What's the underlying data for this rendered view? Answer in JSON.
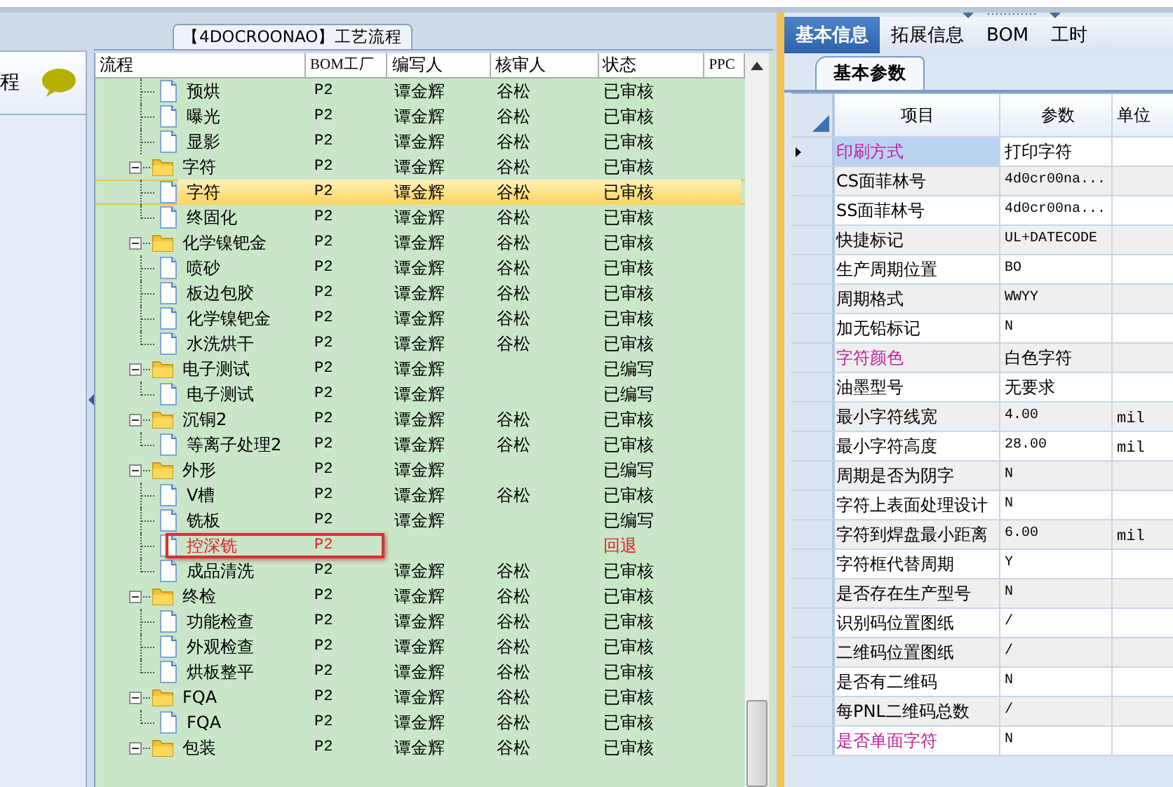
{
  "left_panel": {
    "title": "程"
  },
  "flow_panel": {
    "tab": "【4DOCROONAO】工艺流程",
    "columns": [
      "流程",
      "BOM工厂",
      "编写人",
      "核审人",
      "状态",
      "PPC"
    ],
    "tree": [
      {
        "kind": "step",
        "name": "预烘",
        "bom": "P2",
        "writer": "谭金辉",
        "reviewer": "谷松",
        "status": "已审核",
        "selected": false,
        "flagged": false
      },
      {
        "kind": "step",
        "name": "曝光",
        "bom": "P2",
        "writer": "谭金辉",
        "reviewer": "谷松",
        "status": "已审核",
        "selected": false,
        "flagged": false
      },
      {
        "kind": "step",
        "name": "显影",
        "bom": "P2",
        "writer": "谭金辉",
        "reviewer": "谷松",
        "status": "已审核",
        "selected": false,
        "flagged": false
      },
      {
        "kind": "folder",
        "name": "字符",
        "bom": "P2",
        "writer": "谭金辉",
        "reviewer": "谷松",
        "status": "已审核",
        "selected": false,
        "flagged": false,
        "expanded": true,
        "children": [
          {
            "kind": "step",
            "name": "字符",
            "bom": "P2",
            "writer": "谭金辉",
            "reviewer": "谷松",
            "status": "已审核",
            "selected": true,
            "flagged": false
          },
          {
            "kind": "step",
            "name": "终固化",
            "bom": "P2",
            "writer": "谭金辉",
            "reviewer": "谷松",
            "status": "已审核",
            "selected": false,
            "flagged": false
          }
        ]
      },
      {
        "kind": "folder",
        "name": "化学镍钯金",
        "bom": "P2",
        "writer": "谭金辉",
        "reviewer": "谷松",
        "status": "已审核",
        "selected": false,
        "flagged": false,
        "expanded": true,
        "children": [
          {
            "kind": "step",
            "name": "喷砂",
            "bom": "P2",
            "writer": "谭金辉",
            "reviewer": "谷松",
            "status": "已审核",
            "selected": false,
            "flagged": false
          },
          {
            "kind": "step",
            "name": "板边包胶",
            "bom": "P2",
            "writer": "谭金辉",
            "reviewer": "谷松",
            "status": "已审核",
            "selected": false,
            "flagged": false
          },
          {
            "kind": "step",
            "name": "化学镍钯金",
            "bom": "P2",
            "writer": "谭金辉",
            "reviewer": "谷松",
            "status": "已审核",
            "selected": false,
            "flagged": false
          },
          {
            "kind": "step",
            "name": "水洗烘干",
            "bom": "P2",
            "writer": "谭金辉",
            "reviewer": "谷松",
            "status": "已审核",
            "selected": false,
            "flagged": false
          }
        ]
      },
      {
        "kind": "folder",
        "name": "电子测试",
        "bom": "P2",
        "writer": "谭金辉",
        "status": "已编写",
        "selected": false,
        "flagged": false,
        "expanded": true,
        "children": [
          {
            "kind": "step",
            "name": "电子测试",
            "bom": "P2",
            "writer": "谭金辉",
            "status": "已编写",
            "selected": false,
            "flagged": false
          }
        ]
      },
      {
        "kind": "folder",
        "name": "沉铜2",
        "bom": "P2",
        "writer": "谭金辉",
        "reviewer": "谷松",
        "status": "已审核",
        "selected": false,
        "flagged": false,
        "expanded": true,
        "children": [
          {
            "kind": "step",
            "name": "等离子处理2",
            "bom": "P2",
            "writer": "谭金辉",
            "reviewer": "谷松",
            "status": "已审核",
            "selected": false,
            "flagged": false
          }
        ]
      },
      {
        "kind": "folder",
        "name": "外形",
        "bom": "P2",
        "writer": "谭金辉",
        "status": "已编写",
        "selected": false,
        "flagged": false,
        "expanded": true,
        "children": [
          {
            "kind": "step",
            "name": "V槽",
            "bom": "P2",
            "writer": "谭金辉",
            "reviewer": "谷松",
            "status": "已审核",
            "selected": false,
            "flagged": false
          },
          {
            "kind": "step",
            "name": "铣板",
            "bom": "P2",
            "writer": "谭金辉",
            "status": "已编写",
            "selected": false,
            "flagged": false
          },
          {
            "kind": "step",
            "name": "控深铣",
            "bom": "P2",
            "status": "回退",
            "selected": false,
            "flagged": true
          },
          {
            "kind": "step",
            "name": "成品清洗",
            "bom": "P2",
            "writer": "谭金辉",
            "reviewer": "谷松",
            "status": "已审核",
            "selected": false,
            "flagged": false
          }
        ]
      },
      {
        "kind": "folder",
        "name": "终检",
        "bom": "P2",
        "writer": "谭金辉",
        "reviewer": "谷松",
        "status": "已审核",
        "selected": false,
        "flagged": false,
        "expanded": true,
        "children": [
          {
            "kind": "step",
            "name": "功能检查",
            "bom": "P2",
            "writer": "谭金辉",
            "reviewer": "谷松",
            "status": "已审核",
            "selected": false,
            "flagged": false
          },
          {
            "kind": "step",
            "name": "外观检查",
            "bom": "P2",
            "writer": "谭金辉",
            "reviewer": "谷松",
            "status": "已审核",
            "selected": false,
            "flagged": false
          },
          {
            "kind": "step",
            "name": "烘板整平",
            "bom": "P2",
            "writer": "谭金辉",
            "reviewer": "谷松",
            "status": "已审核",
            "selected": false,
            "flagged": false
          }
        ]
      },
      {
        "kind": "folder",
        "name": "FQA",
        "bom": "P2",
        "writer": "谭金辉",
        "reviewer": "谷松",
        "status": "已审核",
        "selected": false,
        "flagged": false,
        "expanded": true,
        "children": [
          {
            "kind": "step",
            "name": "FQA",
            "bom": "P2",
            "writer": "谭金辉",
            "reviewer": "谷松",
            "status": "已审核",
            "selected": false,
            "flagged": false
          }
        ]
      },
      {
        "kind": "folder",
        "name": "包装",
        "bom": "P2",
        "writer": "谭金辉",
        "reviewer": "谷松",
        "status": "已审核",
        "selected": false,
        "flagged": false,
        "expanded": true
      }
    ]
  },
  "info_panel": {
    "tabs": [
      {
        "label": "基本信息",
        "selected": true
      },
      {
        "label": "拓展信息",
        "selected": false
      },
      {
        "label": "BOM",
        "selected": false
      },
      {
        "label": "工时",
        "selected": false
      }
    ],
    "subtabs": [
      {
        "label": "基本参数",
        "selected": true
      }
    ],
    "columns": [
      "项目",
      "参数",
      "单位"
    ],
    "rows": [
      {
        "item": "印刷方式",
        "value": "打印字符",
        "emphasized": true,
        "current": true
      },
      {
        "item": "CS面菲林号",
        "value": "4d0cr00na...",
        "emphasized": false,
        "current": false
      },
      {
        "item": "SS面菲林号",
        "value": "4d0cr00na...",
        "emphasized": false,
        "current": false
      },
      {
        "item": "快捷标记",
        "value": "UL+DATECODE",
        "emphasized": false,
        "current": false
      },
      {
        "item": "生产周期位置",
        "value": "BO",
        "emphasized": false,
        "current": false
      },
      {
        "item": "周期格式",
        "value": "WWYY",
        "emphasized": false,
        "current": false
      },
      {
        "item": "加无铅标记",
        "value": "N",
        "emphasized": false,
        "current": false
      },
      {
        "item": "字符颜色",
        "value": "白色字符",
        "emphasized": true,
        "current": false
      },
      {
        "item": "油墨型号",
        "value": "无要求",
        "emphasized": false,
        "current": false
      },
      {
        "item": "最小字符线宽",
        "value": "4.00",
        "unit": "mil",
        "emphasized": false,
        "current": false
      },
      {
        "item": "最小字符高度",
        "value": "28.00",
        "unit": "mil",
        "emphasized": false,
        "current": false
      },
      {
        "item": "周期是否为阴字",
        "value": "N",
        "emphasized": false,
        "current": false
      },
      {
        "item": "字符上表面处理设计",
        "value": "N",
        "emphasized": false,
        "current": false
      },
      {
        "item": "字符到焊盘最小距离",
        "value": "6.00",
        "unit": "mil",
        "emphasized": false,
        "current": false
      },
      {
        "item": "字符框代替周期",
        "value": "Y",
        "emphasized": false,
        "current": false
      },
      {
        "item": "是否存在生产型号",
        "value": "N",
        "emphasized": false,
        "current": false
      },
      {
        "item": "识别码位置图纸",
        "value": "/",
        "emphasized": false,
        "current": false
      },
      {
        "item": "二维码位置图纸",
        "value": "/",
        "emphasized": false,
        "current": false
      },
      {
        "item": "是否有二维码",
        "value": "N",
        "emphasized": false,
        "current": false
      },
      {
        "item": "每PNL二维码总数",
        "value": "/",
        "emphasized": false,
        "current": false
      },
      {
        "item": "是否单面字符",
        "value": "N",
        "emphasized": true,
        "current": false
      }
    ]
  }
}
